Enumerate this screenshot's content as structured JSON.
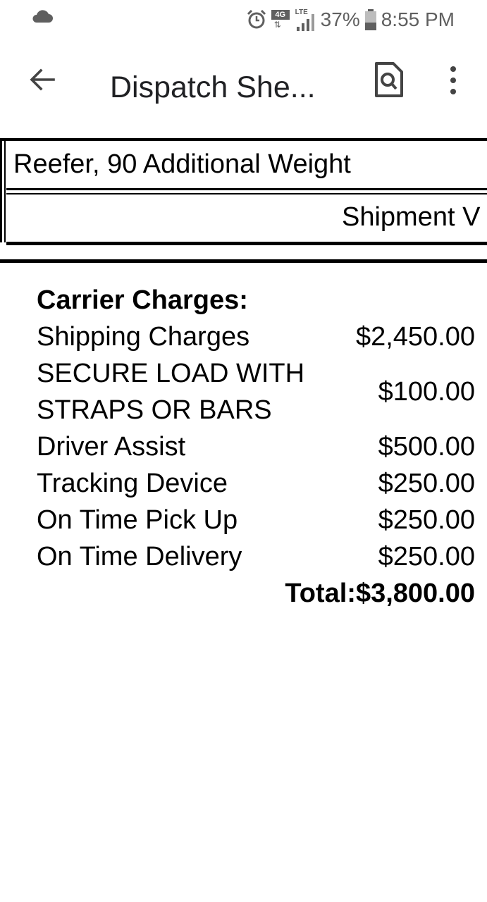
{
  "status_bar": {
    "icons": [
      "cloud-icon",
      "alarm-icon",
      "4g-icon",
      "lte-signal-icon",
      "battery-icon"
    ],
    "network_4g": "4G",
    "network_lte": "LTE",
    "battery_percent": "37%",
    "time": "8:55 PM"
  },
  "app_bar": {
    "title": "Dispatch She...",
    "icons": [
      "back-arrow-icon",
      "document-search-icon",
      "more-vert-icon"
    ]
  },
  "document": {
    "table_row1": "Reefer, 90 Additional Weight",
    "table_row2": "Shipment V",
    "charges_heading": "Carrier Charges:",
    "charges": [
      {
        "label": "Shipping Charges",
        "amount": "$2,450.00"
      },
      {
        "label": "SECURE LOAD WITH STRAPS OR BARS",
        "amount": "$100.00"
      },
      {
        "label": "Driver Assist",
        "amount": "$500.00"
      },
      {
        "label": "Tracking Device",
        "amount": "$250.00"
      },
      {
        "label": "On Time Pick Up",
        "amount": "$250.00"
      },
      {
        "label": "On Time Delivery",
        "amount": "$250.00"
      }
    ],
    "total_label": "Total:",
    "total_amount": "$3,800.00"
  }
}
